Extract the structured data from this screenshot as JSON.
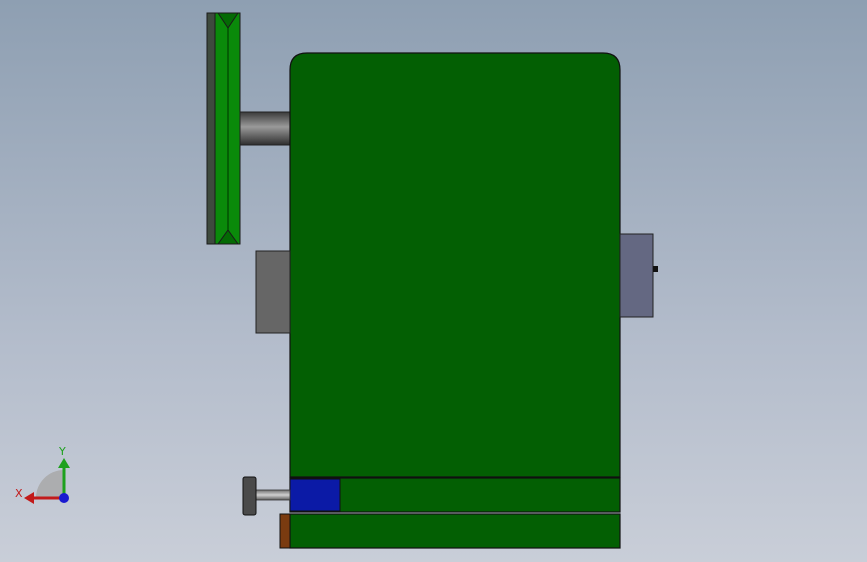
{
  "viewport": {
    "background_top": "#8e9fb2",
    "background_bottom": "#c9ced8"
  },
  "model": {
    "housing_color": "#035f03",
    "pulley_color": "#0a8a0a",
    "shaft_color": "#5a5a5a",
    "motor_color": "#646882",
    "blue_block_color": "#0b1aa6",
    "brown_block_color": "#7a3b10"
  },
  "triad": {
    "x_label": "X",
    "y_label": "Y",
    "x_color": "#c21a1a",
    "y_color": "#1da11d",
    "z_color": "#1a1ad0"
  }
}
